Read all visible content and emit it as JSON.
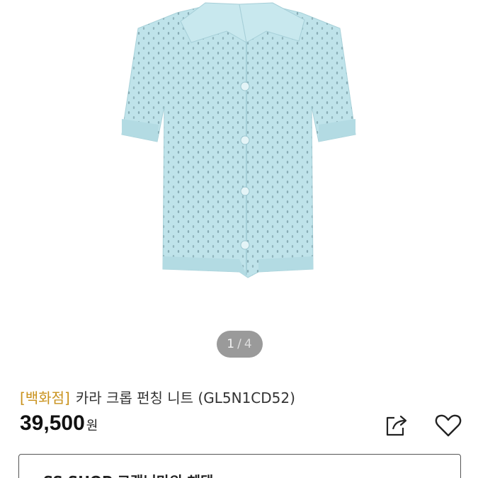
{
  "gallery": {
    "current_page": "1",
    "separator": "/",
    "total_pages": "4"
  },
  "product": {
    "store_tag": "[백화점]",
    "name": "카라 크롭 펀칭 니트 (GL5N1CD52)",
    "price": "39,500",
    "price_unit": "원",
    "garment_color": "#bfe3ea"
  },
  "actions": {
    "share_icon": "share-icon",
    "like_icon": "heart-icon"
  },
  "benefit": {
    "label": "SS SHOP 고객님만의 혜택"
  },
  "colors": {
    "store_tag": "#c9921c",
    "indicator_bg": "#9a9a9a"
  }
}
